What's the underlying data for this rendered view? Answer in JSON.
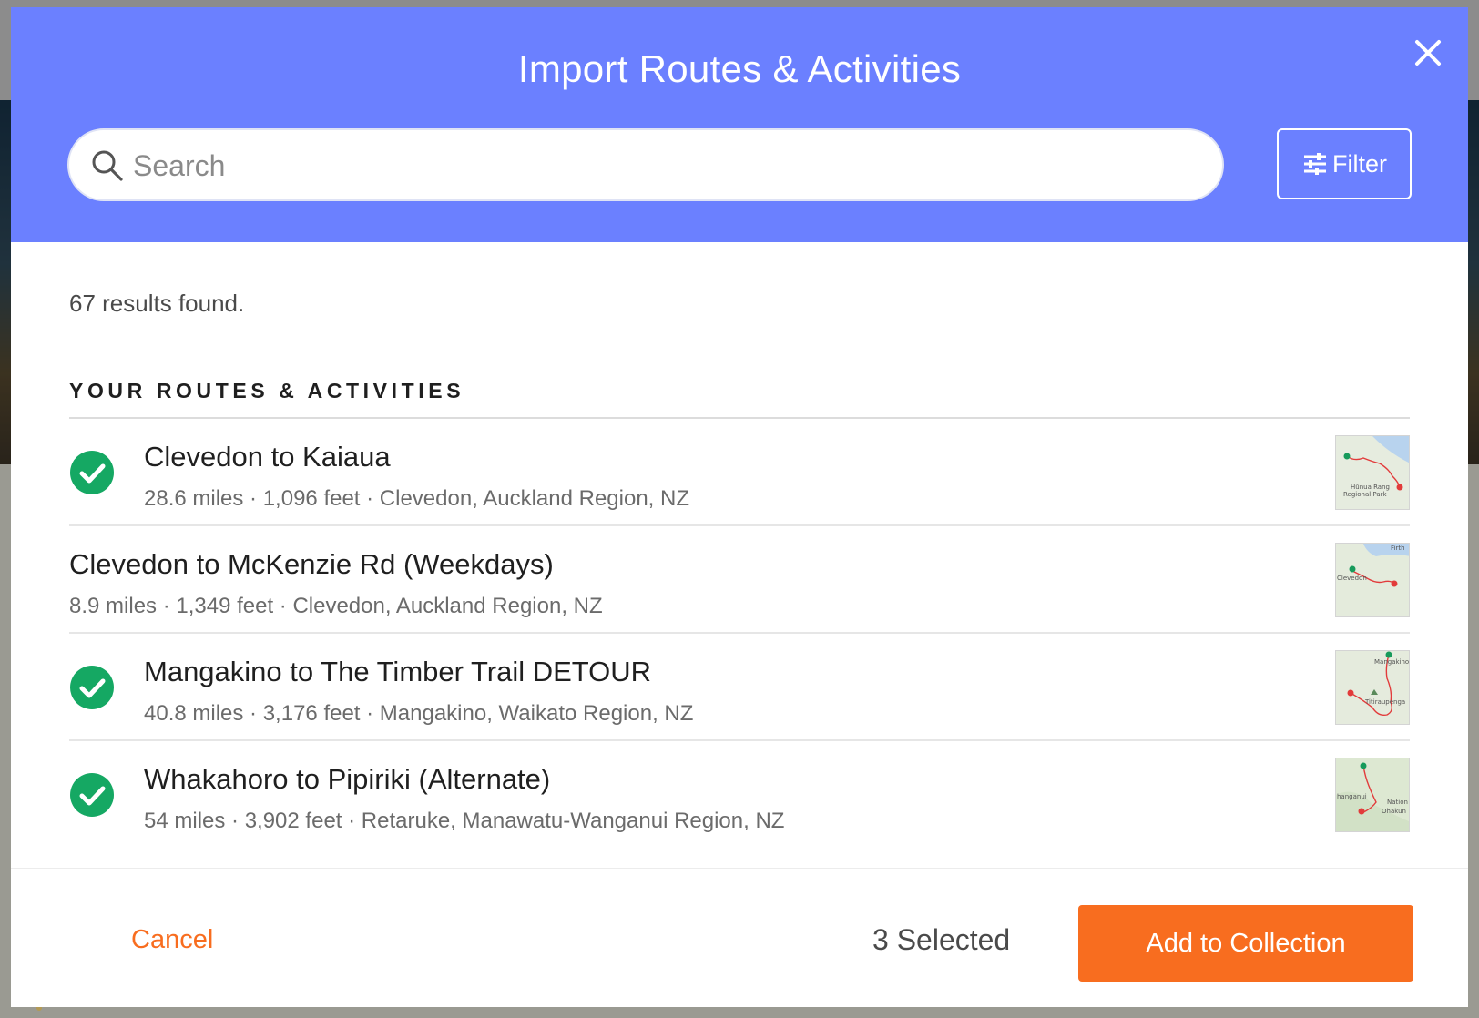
{
  "modal": {
    "title": "Import Routes & Activities",
    "close_icon": "close-icon"
  },
  "search": {
    "placeholder": "Search",
    "value": "",
    "icon": "search-icon"
  },
  "filter": {
    "label": "Filter",
    "icon": "sliders-icon"
  },
  "results": {
    "count_text": "67 results found."
  },
  "section": {
    "heading": "YOUR ROUTES & ACTIVITIES"
  },
  "routes": [
    {
      "title": "Clevedon to Kaiaua",
      "meta": "28.6 miles · 1,096 feet · Clevedon, Auckland Region, NZ",
      "selected": true,
      "map_labels": [
        "Hūnua Rang",
        "Regional Park"
      ]
    },
    {
      "title": "Clevedon to McKenzie Rd (Weekdays)",
      "meta": "8.9 miles · 1,349 feet · Clevedon, Auckland Region, NZ",
      "selected": false,
      "map_labels": [
        "Firth",
        "Clevedon"
      ]
    },
    {
      "title": "Mangakino to The Timber Trail DETOUR",
      "meta": "40.8 miles · 3,176 feet · Mangakino, Waikato Region, NZ",
      "selected": true,
      "map_labels": [
        "Mangakino",
        "Titiraupenga"
      ]
    },
    {
      "title": "Whakahoro to Pipiriki (Alternate)",
      "meta": "54 miles · 3,902 feet · Retaruke, Manawatu-Wanganui Region, NZ",
      "selected": true,
      "map_labels": [
        "hanganui",
        "Nation",
        "Ohakun"
      ]
    }
  ],
  "footer": {
    "cancel_label": "Cancel",
    "selected_text": "3 Selected",
    "add_label": "Add to Collection"
  },
  "colors": {
    "header": "#6b80ff",
    "accent": "#f86d1f",
    "check": "#15a863",
    "route_line": "#e23b3b"
  }
}
